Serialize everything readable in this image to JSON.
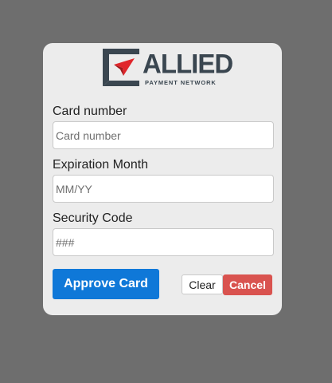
{
  "logo": {
    "word": "ALLIED",
    "subtitle": "PAYMENT NETWORK"
  },
  "form": {
    "card_number": {
      "label": "Card number",
      "placeholder": "Card number",
      "value": ""
    },
    "expiration": {
      "label": "Expiration Month",
      "placeholder": "MM/YY",
      "value": ""
    },
    "security_code": {
      "label": "Security Code",
      "placeholder": "###",
      "value": ""
    }
  },
  "buttons": {
    "approve": "Approve Card",
    "clear": "Clear",
    "cancel": "Cancel"
  },
  "colors": {
    "page_background": "#6e6e6e",
    "panel_background": "#ececec",
    "approve": "#0f78d8",
    "cancel": "#d9534f",
    "logo_dark": "#3a4650",
    "logo_accent": "#e0262b"
  }
}
